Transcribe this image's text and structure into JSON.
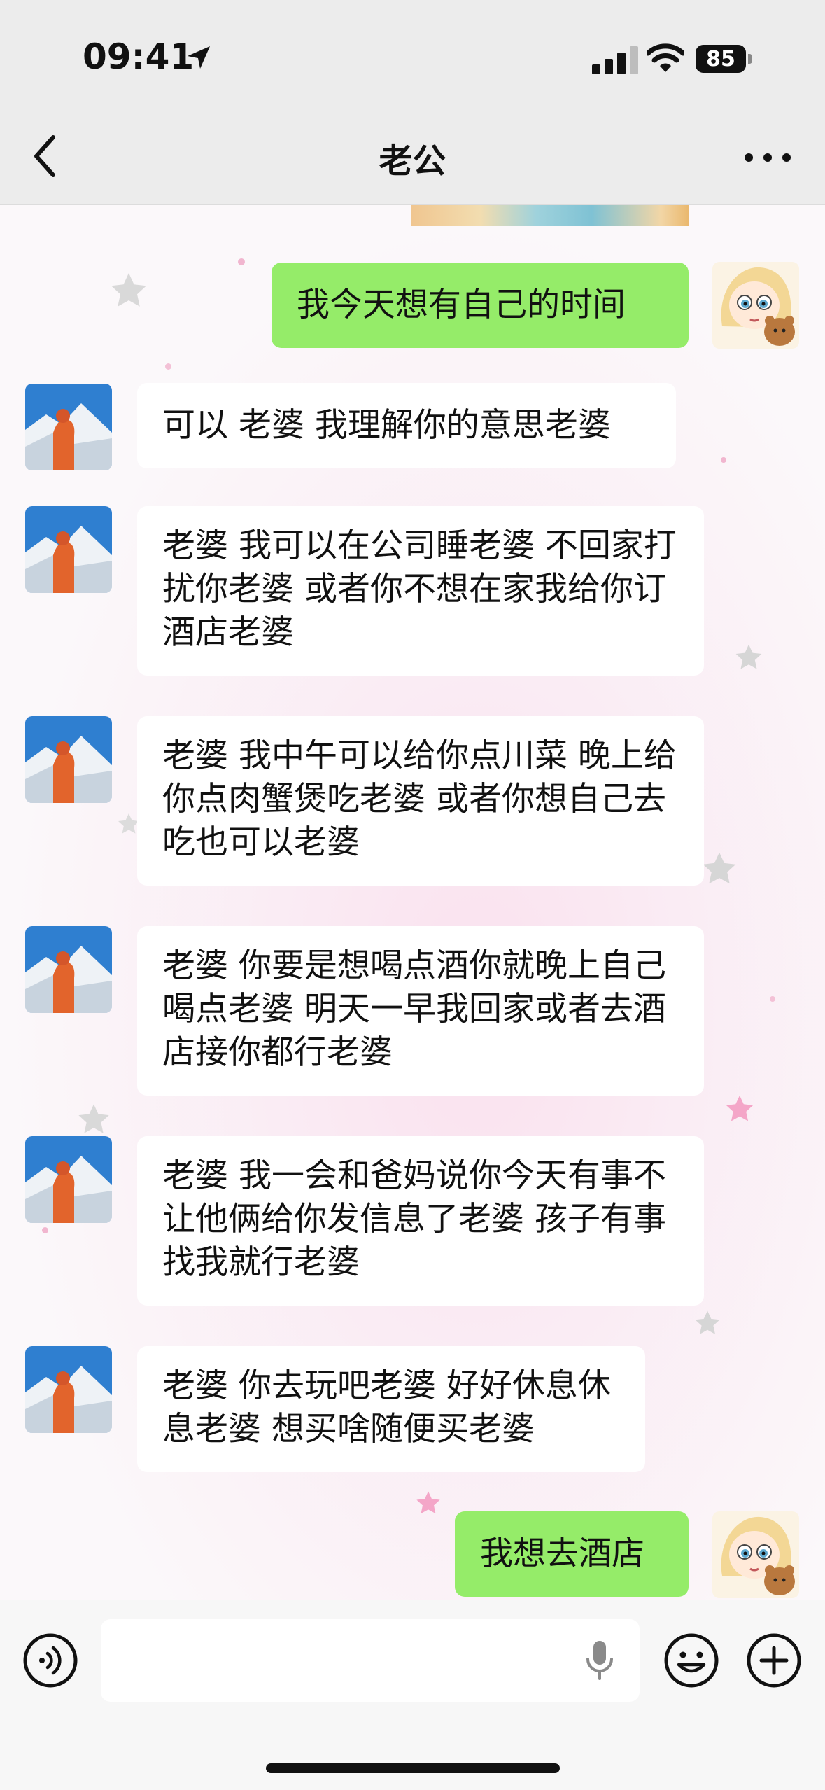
{
  "status_bar": {
    "time": "09:41",
    "battery": "85",
    "icons": [
      "location-arrow-icon",
      "cellular-signal-icon",
      "wifi-icon",
      "battery-icon"
    ]
  },
  "nav": {
    "title": "老公",
    "back_icon": "chevron-left-icon",
    "more_icon": "more-dots-icon"
  },
  "messages": [
    {
      "from": "me",
      "text": "我今天想有自己的时间"
    },
    {
      "from": "other",
      "text": "可以 老婆 我理解你的意思老婆"
    },
    {
      "from": "other",
      "text": "老婆 我可以在公司睡老婆 不回家打扰你老婆 或者你不想在家我给你订酒店老婆"
    },
    {
      "from": "other",
      "text": "老婆 我中午可以给你点川菜 晚上给你点肉蟹煲吃老婆 或者你想自己去吃也可以老婆"
    },
    {
      "from": "other",
      "text": "老婆 你要是想喝点酒你就晚上自己喝点老婆 明天一早我回家或者去酒店接你都行老婆"
    },
    {
      "from": "other",
      "text": "老婆 我一会和爸妈说你今天有事不让他俩给你发信息了老婆 孩子有事找我就行老婆"
    },
    {
      "from": "other",
      "text": "老婆 你去玩吧老婆 好好休息休息老婆 想买啥随便买老婆"
    },
    {
      "from": "me",
      "text": "我想去酒店"
    }
  ],
  "input_bar": {
    "placeholder": "",
    "icons": [
      "voice-mode-icon",
      "microphone-icon",
      "emoji-icon",
      "plus-icon"
    ]
  },
  "colors": {
    "outgoing_bubble": "#95ec69",
    "incoming_bubble": "#ffffff",
    "header_bg": "#ececec"
  }
}
